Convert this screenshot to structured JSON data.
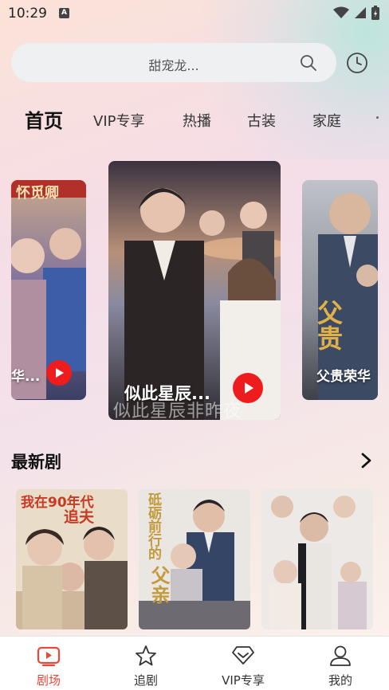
{
  "status_bar": {
    "time": "10:29",
    "notif_glyph": "A"
  },
  "search": {
    "placeholder_text": "甜宠龙..."
  },
  "tabs": [
    {
      "label": "首页",
      "active": true
    },
    {
      "label": "VIP专享"
    },
    {
      "label": "热播"
    },
    {
      "label": "古装"
    },
    {
      "label": "家庭"
    }
  ],
  "carousel": [
    {
      "title": "华...",
      "poster_text": "怀觅卿"
    },
    {
      "title": "似此星辰...",
      "poster_text": "似此星辰非昨夜"
    },
    {
      "title": "父贵荣华",
      "poster_text": "父贵"
    }
  ],
  "latest": {
    "title": "最新剧",
    "items": [
      {
        "poster_text_1": "我在90年代",
        "poster_text_2": "追夫"
      },
      {
        "poster_text_1": "砥砺前行的",
        "poster_text_2": "父亲"
      },
      {
        "poster_text_1": "",
        "poster_text_2": ""
      }
    ]
  },
  "bottom_nav": [
    {
      "label": "剧场",
      "icon": "video-icon",
      "active": true
    },
    {
      "label": "追剧",
      "icon": "star-icon"
    },
    {
      "label": "VIP专享",
      "icon": "diamond-icon"
    },
    {
      "label": "我的",
      "icon": "user-icon"
    }
  ],
  "colors": {
    "accent": "#e8483a",
    "play": "#ee1c1c"
  }
}
